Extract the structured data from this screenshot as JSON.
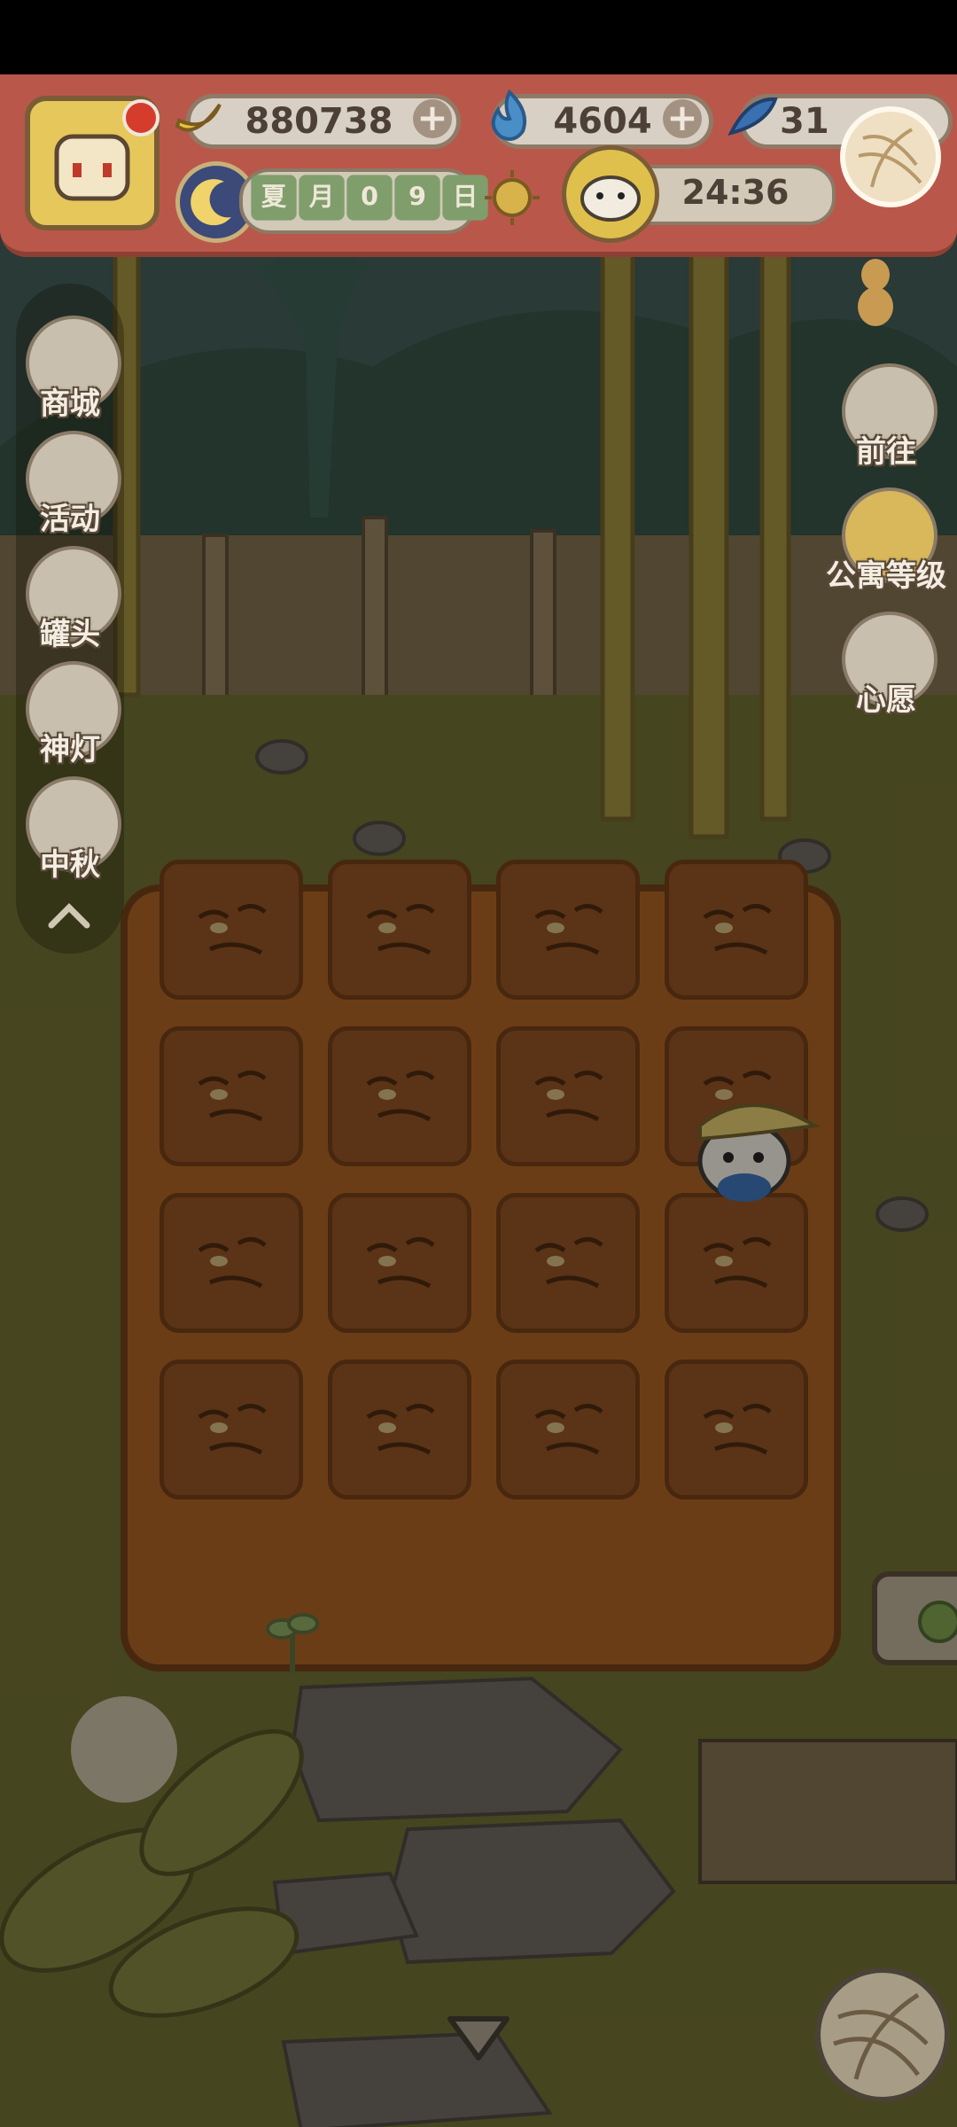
{
  "resources": {
    "banana": {
      "value": "880738",
      "icon": "banana-icon"
    },
    "flame": {
      "value": "4604",
      "icon": "blue-flame-icon"
    },
    "fish": {
      "value": "31",
      "icon": "blue-fish-icon"
    }
  },
  "calendar": {
    "chars": [
      "夏",
      "月",
      "0",
      "9",
      "日"
    ]
  },
  "timer": {
    "value": "24:36"
  },
  "left_menu": [
    {
      "label": "商城",
      "icon": "shop-icon"
    },
    {
      "label": "活动",
      "icon": "gift-icon"
    },
    {
      "label": "罐头",
      "icon": "can-icon"
    },
    {
      "label": "神灯",
      "icon": "lamp-icon"
    },
    {
      "label": "中秋",
      "icon": "mid-autumn-icon"
    }
  ],
  "right_menu": [
    {
      "label": "前往",
      "icon": "map-pin-icon"
    },
    {
      "label": "公寓等级",
      "icon": "apartment-level-icon"
    },
    {
      "label": "心愿",
      "icon": "wish-book-icon"
    }
  ],
  "colors": {
    "topbar": "#b9584a",
    "soil": "#8c4f22",
    "grass": "#6f6c30",
    "overlay": "rgba(0,0,0,0.45)"
  }
}
